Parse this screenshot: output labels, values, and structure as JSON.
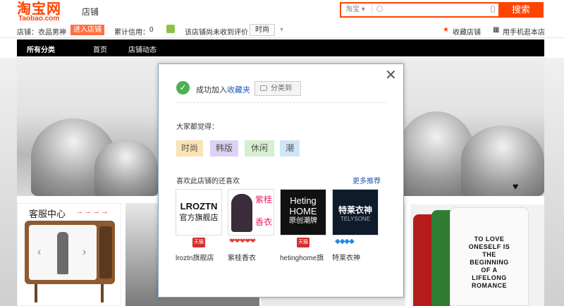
{
  "header": {
    "logo_cn": "淘宝网",
    "logo_en": "Taobao.com",
    "shop_label": "店铺",
    "search": {
      "scope": "淘宝",
      "scope_arrow": "▾",
      "placeholder": ""
    },
    "search_button": "搜索"
  },
  "infobar": {
    "shop_prefix": "店铺：",
    "shop_name": "衣品男神",
    "enter_button": "进入店铺",
    "credit_label": "累计信用：",
    "credit_value": "0",
    "no_review": "该店铺尚未收到评价",
    "style_tag": "时尚",
    "style_arrow": "▾",
    "favorite": "收藏店铺",
    "mobile": "用手机逛本店"
  },
  "nav": {
    "items": [
      "所有分类",
      "首页",
      "店铺动态"
    ]
  },
  "service": {
    "title": "客服中心",
    "arrows": "→→→→"
  },
  "popup": {
    "close": "✕",
    "success_prefix": "成功加入",
    "success_link": "收藏夹",
    "category_button": "分类到",
    "everyone_title": "大家都觉得：",
    "tags": [
      {
        "label": "时尚",
        "color": "#fbe3b5"
      },
      {
        "label": "韩版",
        "color": "#ddd2f6"
      },
      {
        "label": "休闲",
        "color": "#d5efcf"
      },
      {
        "label": "潮",
        "color": "#cfe6f7"
      }
    ],
    "liked_title": "喜欢此店铺的还喜欢",
    "more_link": "更多推荐",
    "shops": [
      {
        "logo_line1": "LROZTN",
        "logo_line2": "官方旗舰店",
        "badge": "天猫",
        "name": "lroztn旗舰店"
      },
      {
        "logo_line1": "紫桂",
        "logo_line2": "香衣",
        "badge": "❤❤❤❤❤",
        "name": "紫桂香衣"
      },
      {
        "logo_line1": "Heting",
        "logo_line2": "HOME",
        "logo_line3": "原创潮牌",
        "badge": "天猫",
        "name": "hetinghome旗"
      },
      {
        "logo_line1": "特莱衣神",
        "logo_line2": "TELYSONE",
        "badge": "◆◆◆◆",
        "name": "特莱衣神"
      }
    ]
  },
  "shirt_print": [
    "TO LOVE",
    "ONESELF IS",
    "THE",
    "BEGINNING",
    "OF A",
    "LIFELONG",
    "ROMANCE"
  ]
}
